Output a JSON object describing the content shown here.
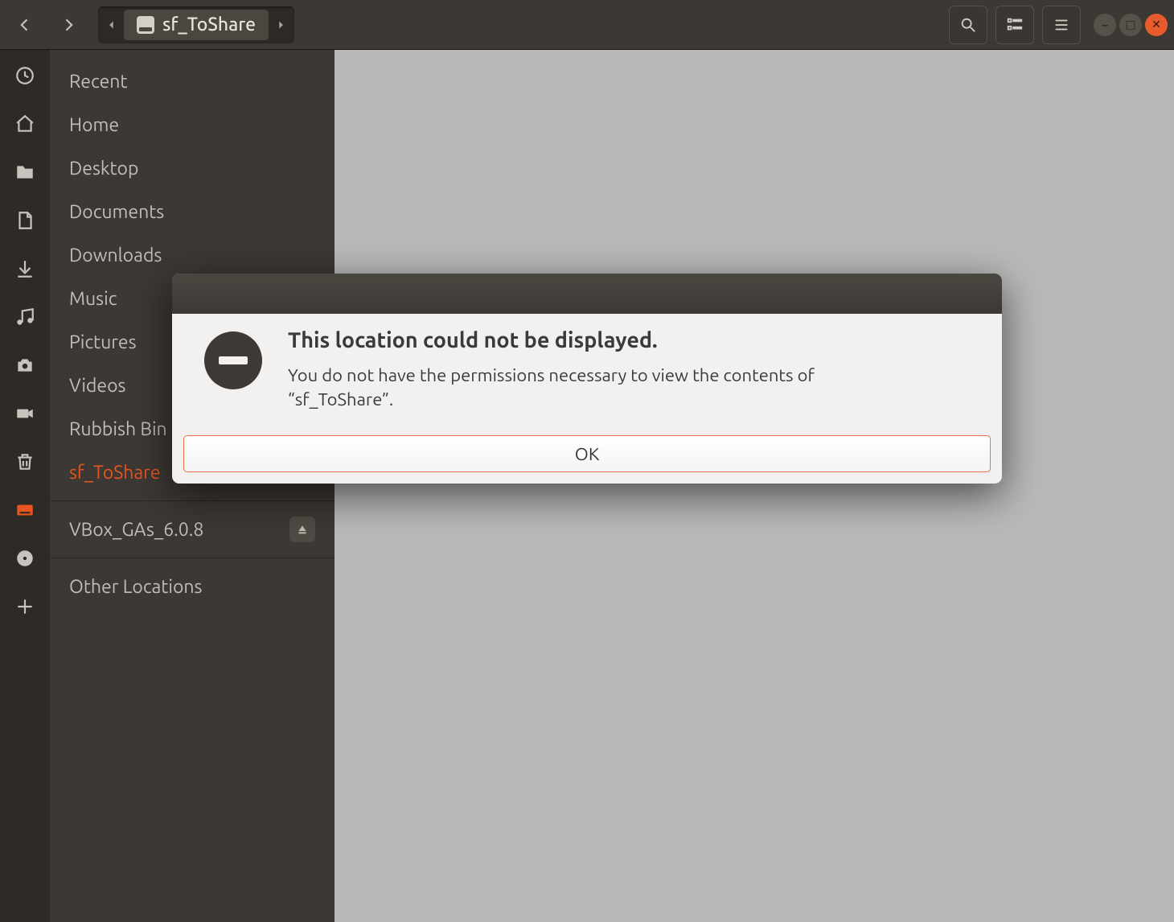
{
  "header": {
    "path_crumb": "sf_ToShare"
  },
  "sidebar": {
    "items": [
      {
        "label": "Recent",
        "icon": "clock-icon"
      },
      {
        "label": "Home",
        "icon": "home-icon"
      },
      {
        "label": "Desktop",
        "icon": "folder-icon"
      },
      {
        "label": "Documents",
        "icon": "document-icon"
      },
      {
        "label": "Downloads",
        "icon": "download-icon"
      },
      {
        "label": "Music",
        "icon": "music-icon"
      },
      {
        "label": "Pictures",
        "icon": "camera-icon"
      },
      {
        "label": "Videos",
        "icon": "video-icon"
      },
      {
        "label": "Rubbish Bin",
        "icon": "trash-icon"
      },
      {
        "label": "sf_ToShare",
        "icon": "drive-icon",
        "active": true
      }
    ],
    "mounts": [
      {
        "label": "VBox_GAs_6.0.8",
        "icon": "disc-icon",
        "ejectable": true
      }
    ],
    "other": {
      "label": "Other Locations",
      "icon": "plus-icon"
    }
  },
  "dialog": {
    "heading": "This location could not be displayed.",
    "message": "You do not have the permissions necessary to view the contents of “sf_ToShare”.",
    "ok_label": "OK"
  }
}
